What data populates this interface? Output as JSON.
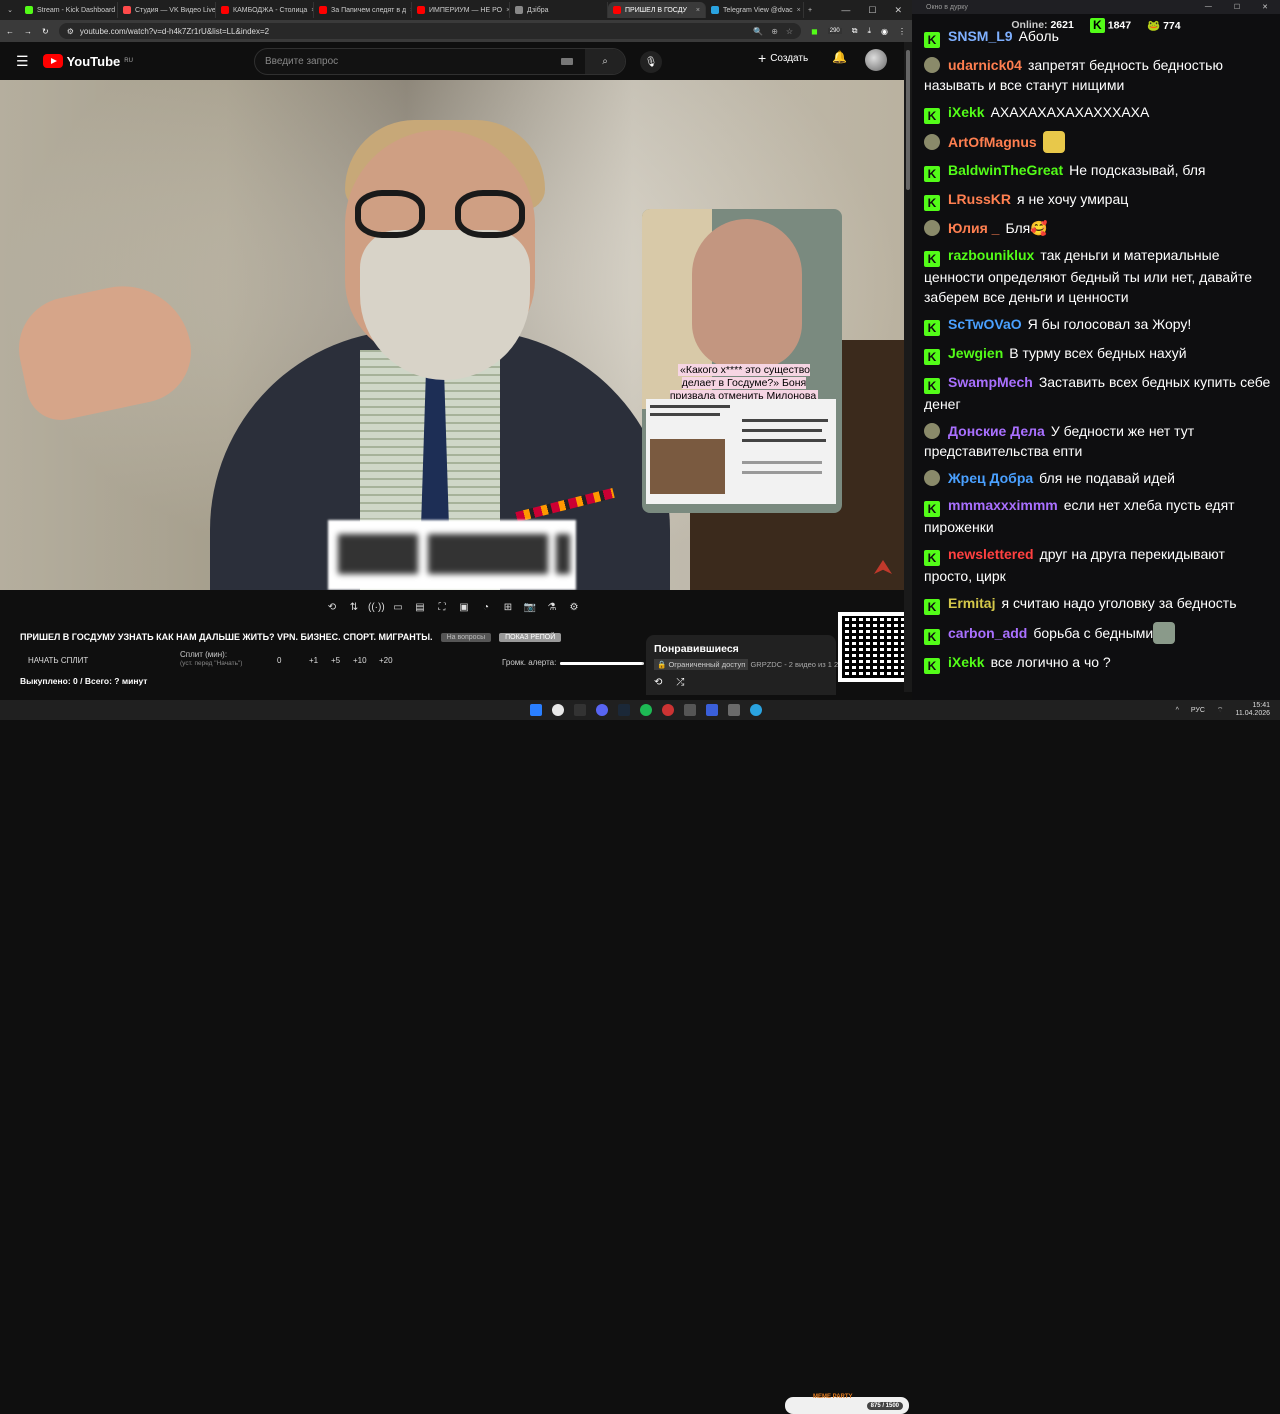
{
  "tabs": [
    {
      "label": "Stream - Kick Dashboard",
      "color": "#53fc18"
    },
    {
      "label": "Студия — VK Видео Live",
      "color": "#ff4a4a"
    },
    {
      "label": "КАМБОДЖА - Столица",
      "color": "#ff0000"
    },
    {
      "label": "За Папичем следят в д",
      "color": "#ff0000"
    },
    {
      "label": "ИМПЕРИУМ — НЕ РО",
      "color": "#ff0000"
    },
    {
      "label": "Дзібра",
      "color": "#888888"
    },
    {
      "label": "ПРИШЕЛ В ГОСДУ",
      "color": "#ff0000"
    },
    {
      "label": "Telegram View @dvac",
      "color": "#2aa3e0"
    }
  ],
  "address": {
    "url": "youtube.com/watch?v=d-h4k7Zr1rU&list=LL&index=2",
    "ext_badge": "290"
  },
  "youtube": {
    "logo_text": "YouTube",
    "region": "RU",
    "search_placeholder": "Введите запрос",
    "create_label": "Создать"
  },
  "overlay_caption": "«Какого х**** это существо делает в Госдуме?» Боня призвала отменить Милонова",
  "video_info": {
    "title": "ПРИШЕЛ В ГОСДУМУ УЗНАТЬ КАК НАМ ДАЛЬШЕ ЖИТЬ? VPN. БИЗНЕС. СПОРТ. МИГРАНТЫ.",
    "chip_a": "На вопросы",
    "chip_b": "ПОКАЗ РЕПОЙ",
    "split_label": "НАЧАТЬ СПЛИТ",
    "split_min_label": "Сплит (мин):",
    "split_hint": "(уст. перед \"Начать\")",
    "split_values": [
      "0",
      "+1",
      "+5",
      "+10",
      "+20"
    ],
    "volume_label": "Громк. алерта:",
    "volume_level": 0.98,
    "total": "Выкуплено: 0 / Всего: ? минут"
  },
  "playlist": {
    "title": "Понравившиеся",
    "access": "Ограниченный доступ",
    "meta": "GRPZDC - 2 видео из 1 2"
  },
  "chat": {
    "window_title": "Окно в дурку",
    "online_label": "Online:",
    "online": "2621",
    "kick_count": "1847",
    "frog_count": "774",
    "messages": [
      {
        "user": "SNSM_L9",
        "color": "#7fb0ff",
        "badge": "k",
        "text": "Аболь"
      },
      {
        "user": "udarnick04",
        "color": "#ff7f50",
        "badge": "f",
        "text": "запретят бедность бедностью называть и все станут нищими"
      },
      {
        "user": "iXekk",
        "color": "#53fc18",
        "badge": "k",
        "text": "АХАХАХАХАХАХХХАХА"
      },
      {
        "user": "ArtOfMagnus",
        "color": "#ff7f50",
        "badge": "f",
        "text": ""
      },
      {
        "user": "BaldwinTheGreat",
        "color": "#53fc18",
        "badge": "k",
        "text": "Не подсказывай, бля"
      },
      {
        "user": "LRussKR",
        "color": "#ff7f50",
        "badge": "k",
        "text": "я не хочу умирац"
      },
      {
        "user": "Юлия _",
        "color": "#ff7f50",
        "badge": "f",
        "text": "Бля🥰"
      },
      {
        "user": "razbouniklux",
        "color": "#53fc18",
        "badge": "k",
        "text": "так деньги и материальные ценности определяют бедный ты или нет, давайте заберем все деньги и ценности"
      },
      {
        "user": "ScTwOVaO",
        "color": "#4aa0ff",
        "badge": "k",
        "text": "Я бы голосовал за Жору!"
      },
      {
        "user": "Jewgien",
        "color": "#53fc18",
        "badge": "k",
        "text": "В турму всех бедных нахуй"
      },
      {
        "user": "SwampMech",
        "color": "#a970ff",
        "badge": "k",
        "text": "Заставить всех бедных купить себе денег"
      },
      {
        "user": "Донские Дела",
        "color": "#a970ff",
        "badge": "f",
        "text": "У бедности же нет тут представительства епти"
      },
      {
        "user": "Жрец Добра",
        "color": "#4aa0ff",
        "badge": "f",
        "text": "бля не подавай идей"
      },
      {
        "user": "mmmaxxximmm",
        "color": "#a970ff",
        "badge": "k",
        "text": "если нет хлеба пусть едят пироженки"
      },
      {
        "user": "newslettered",
        "color": "#ff4040",
        "badge": "k",
        "text": "друг на друга перекидывают просто, цирк"
      },
      {
        "user": "Ermitaj",
        "color": "#d4c84a",
        "badge": "k",
        "text": "я считаю надо уголовку за бедность"
      },
      {
        "user": "carbon_add",
        "color": "#a970ff",
        "badge": "k",
        "text": "борьба с бедными"
      },
      {
        "user": "iXekk",
        "color": "#53fc18",
        "badge": "k",
        "text": "все логично а чо ?"
      }
    ]
  },
  "taskbar": {
    "lang": "РУС",
    "time": "15:41",
    "date": "11.04.2026",
    "meme_label": "MEME PARTY",
    "meme_progress": "875 / 1500"
  }
}
